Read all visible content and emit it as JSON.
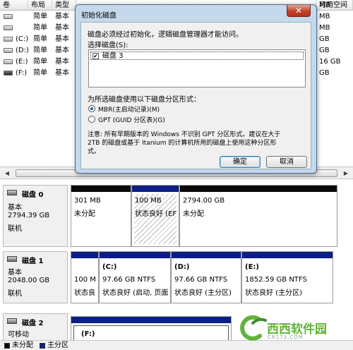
{
  "volume_list": {
    "columns": [
      "卷",
      "布局",
      "类型",
      "",
      "MB",
      "可用空间"
    ],
    "rows": [
      {
        "volume": "",
        "layout": "简单",
        "type": "基本",
        "right": "MB"
      },
      {
        "volume": "",
        "layout": "简单",
        "type": "基本",
        "right": "MB"
      },
      {
        "volume": "(C:)",
        "layout": "简单",
        "type": "基本",
        "right": "GB"
      },
      {
        "volume": "(D:)",
        "layout": "简单",
        "type": "基本",
        "right": "GB"
      },
      {
        "volume": "(E:)",
        "layout": "简单",
        "type": "基本",
        "right": "16 GB"
      },
      {
        "volume": "(F:)",
        "layout": "简单",
        "type": "基本",
        "right": "GB"
      }
    ]
  },
  "disks": [
    {
      "name": "磁盘 0",
      "type": "基本",
      "size": "2794.39 GB",
      "status": "联机",
      "partitions": [
        {
          "label": "",
          "size": "301 MB",
          "status": "未分配"
        },
        {
          "label": "",
          "size": "100 MB",
          "status": "状态良好 (EF"
        },
        {
          "label": "",
          "size": "2794.00 GB",
          "status": "未分配"
        }
      ]
    },
    {
      "name": "磁盘 1",
      "type": "基本",
      "size": "2048.00 GB",
      "status": "联机",
      "partitions": [
        {
          "label": "",
          "size": "100 M",
          "status": "状态良"
        },
        {
          "label": "(C:)",
          "size": "97.66 GB NTFS",
          "status": "状态良好 (启动, 页面"
        },
        {
          "label": "(D:)",
          "size": "97.66 GB NTFS",
          "status": "状态良好 (主分区)"
        },
        {
          "label": "(E:)",
          "size": "1852.59 GB NTFS",
          "status": "状态良好 (主分区)"
        }
      ]
    },
    {
      "name": "磁盘 2",
      "type": "可移动",
      "partitions": [
        {
          "label": "(F:)"
        }
      ]
    }
  ],
  "legend": {
    "unallocated": "未分配",
    "primary": "主分区"
  },
  "watermark": {
    "brand": "西西软件园",
    "site": "CR173.COM"
  },
  "dialog": {
    "title": "初始化磁盘",
    "close_label": "✕",
    "intro": "磁盘必须经过初始化，逻辑磁盘管理器才能访问。",
    "select_label": "选择磁盘(S):",
    "disk_item": "磁盘 3",
    "disk_checked": true,
    "style_label": "为所选磁盘使用以下磁盘分区形式：",
    "options": [
      {
        "label": "MBR(主启动记录)(M)",
        "checked": true
      },
      {
        "label": "GPT (GUID 分区表)(G)",
        "checked": false
      }
    ],
    "note_line1": "注意: 所有早期版本的 Windows 不识别 GPT 分区形式。建议在大于",
    "note_line2": "2TB 的磁盘或基于 Itanium 的计算机所用的磁盘上使用这种分区形",
    "note_line3": "式。",
    "ok_label": "确定",
    "cancel_label": "取消"
  },
  "colors": {
    "unallocated": "#0a0a0a",
    "primary": "#0b1f86",
    "brand_green": "#62b33a"
  }
}
